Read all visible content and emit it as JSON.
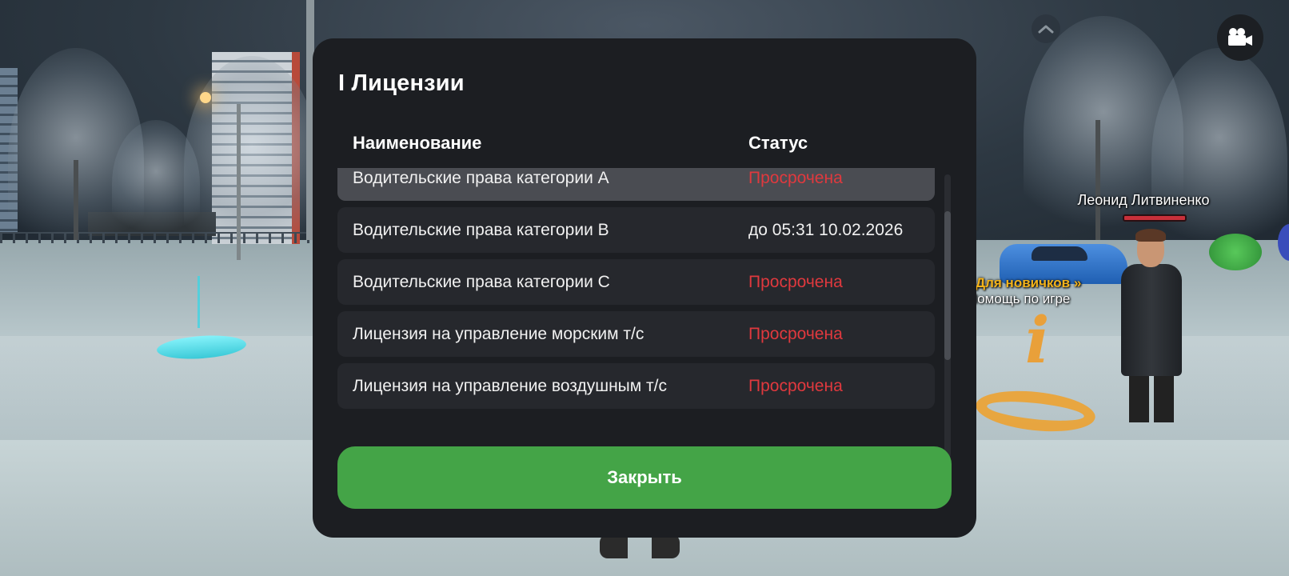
{
  "modal": {
    "title": "I Лицензии",
    "columns": {
      "name": "Наименование",
      "status": "Статус"
    },
    "licenses": [
      {
        "name": "Водительские права категории A",
        "status": "Просрочена",
        "state": "expired"
      },
      {
        "name": "Водительские права категории B",
        "status": "до 05:31 10.02.2026",
        "state": "valid"
      },
      {
        "name": "Водительские права категории C",
        "status": "Просрочена",
        "state": "expired"
      },
      {
        "name": "Лицензия на управление морским т/с",
        "status": "Просрочена",
        "state": "expired"
      },
      {
        "name": "Лицензия на управление воздушным т/с",
        "status": "Просрочена",
        "state": "expired"
      }
    ],
    "close_label": "Закрыть"
  },
  "world": {
    "player_name": "Леонид Литвиненко",
    "hint_title": "Для новичков »",
    "hint_subtitle": "Помощь по игре"
  },
  "hud": {
    "chevron_icon": "chevron-up-icon",
    "camera_icon": "video-camera-icon"
  },
  "colors": {
    "modal_bg": "#1c1e22",
    "row_bg": "#26282d",
    "row_highlight": "#4a4c52",
    "expired": "#e0393e",
    "close_button": "#44a447",
    "hint_title": "#f2b21b"
  }
}
